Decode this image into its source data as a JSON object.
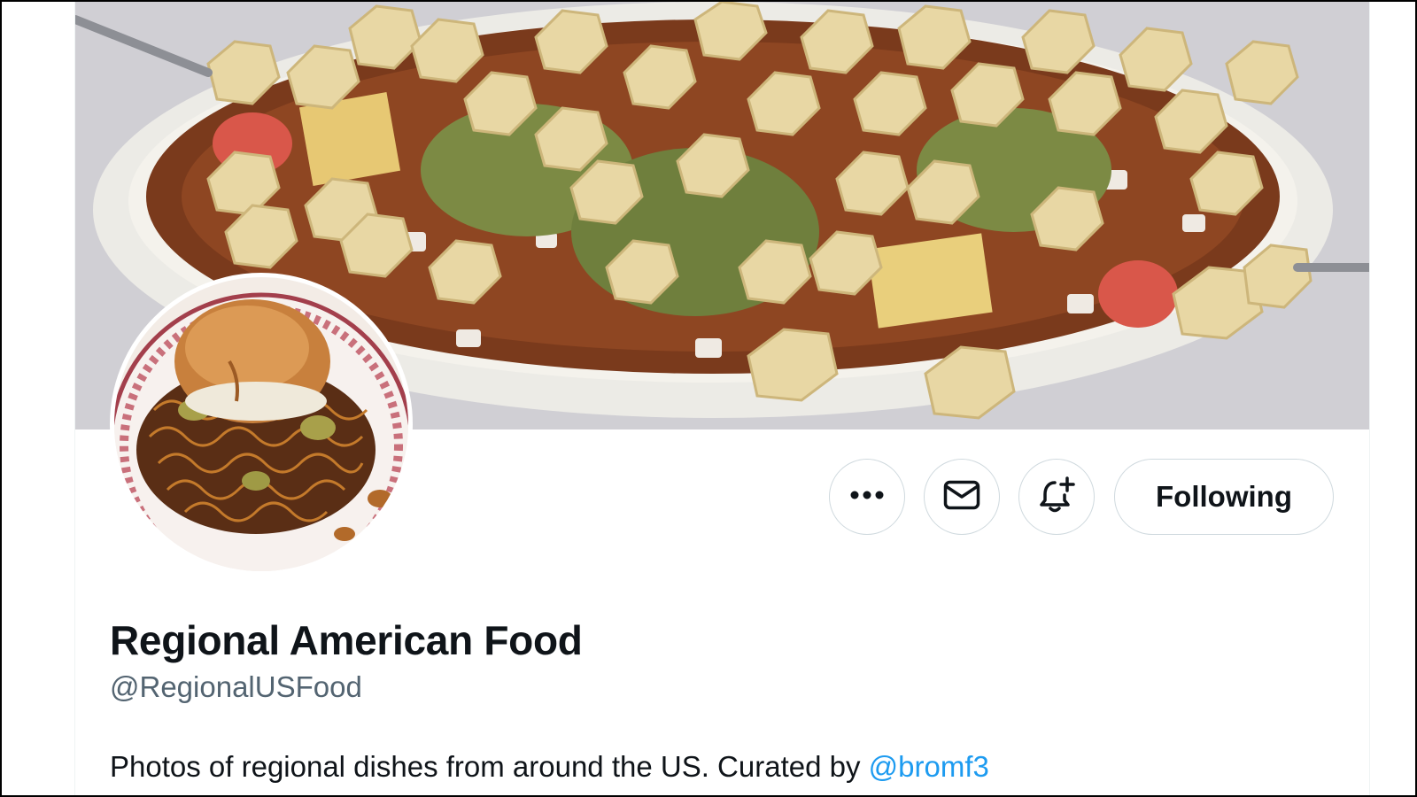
{
  "profile": {
    "display_name": "Regional American Food",
    "handle": "@RegionalUSFood",
    "bio_text": "Photos of regional dishes from around the US. Curated by ",
    "bio_mention": "@bromf3",
    "banner_description": "Banner photo",
    "avatar_description": "Profile photo"
  },
  "actions": {
    "more_icon": "more-horizontal-icon",
    "message_icon": "envelope-icon",
    "notify_icon": "bell-plus-icon",
    "follow_label": "Following"
  },
  "colors": {
    "text_primary": "#0f1419",
    "text_secondary": "#536471",
    "link": "#1d9bf0",
    "border": "#cfd9de",
    "background": "#ffffff"
  }
}
